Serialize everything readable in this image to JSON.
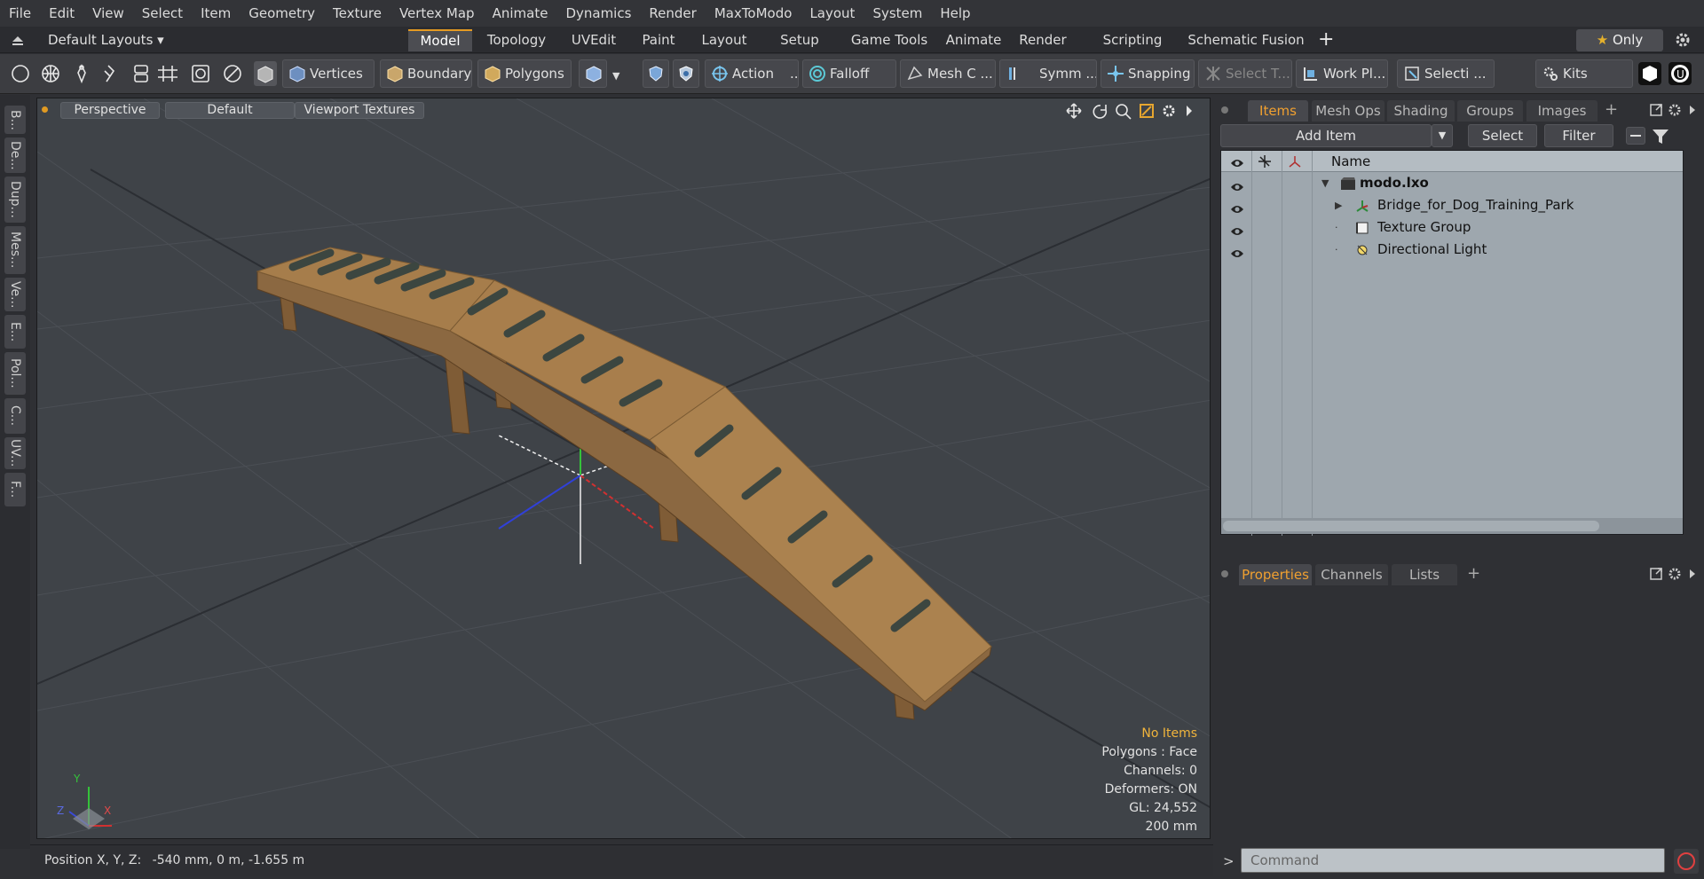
{
  "menu": [
    "File",
    "Edit",
    "View",
    "Select",
    "Item",
    "Geometry",
    "Texture",
    "Vertex Map",
    "Animate",
    "Dynamics",
    "Render",
    "MaxToModo",
    "Layout",
    "System",
    "Help"
  ],
  "layout_selector": "Default Layouts",
  "layout_tabs": [
    "Model",
    "Topology",
    "UVEdit",
    "Paint",
    "Layout",
    "Setup",
    "Game Tools",
    "Animate",
    "Render",
    "Scripting",
    "Schematic Fusion"
  ],
  "active_tab": "Model",
  "only_label": "Only",
  "toolbar": {
    "vertices": "Vertices",
    "boundary": "Boundary",
    "polygons": "Polygons",
    "action": "Action",
    "action_more": "...",
    "falloff": "Falloff",
    "mesh": "Mesh C ...",
    "symm": "Symm ...",
    "snapping": "Snapping",
    "select_t": "Select T...",
    "work_pl": "Work Pl...",
    "selecti": "Selecti ...",
    "kits": "Kits"
  },
  "left_tabs": [
    "B...",
    "De...",
    "Dup...",
    "Mes...",
    "Ve...",
    "E...",
    "Pol...",
    "C...",
    "UV...",
    "F..."
  ],
  "viewport": {
    "perspective": "Perspective",
    "default": "Default",
    "viewport_textures": "Viewport Textures",
    "axis_x_label": "X",
    "axis_y_label": "Y",
    "axis_z_label": "Z",
    "info": {
      "selection": "No Items",
      "polygons": "Polygons : Face",
      "channels": "Channels: 0",
      "deformers": "Deformers: ON",
      "gl": "GL: 24,552",
      "scale": "200 mm"
    }
  },
  "status": {
    "label": "Position X, Y, Z:",
    "value": "-540 mm, 0 m, -1.655 m"
  },
  "items_panel": {
    "tabs": [
      "Items",
      "Mesh Ops",
      "Shading",
      "Groups",
      "Images"
    ],
    "add_item": "Add Item",
    "select": "Select",
    "filter": "Filter",
    "name_header": "Name",
    "rows": [
      {
        "name": "modo.lxo",
        "level": 0,
        "bold": true
      },
      {
        "name": "Bridge_for_Dog_Training_Park",
        "level": 1,
        "bold": false
      },
      {
        "name": "Texture Group",
        "level": 1,
        "bold": false
      },
      {
        "name": "Directional Light",
        "level": 1,
        "bold": false
      }
    ]
  },
  "props_panel": {
    "tabs": [
      "Properties",
      "Channels",
      "Lists"
    ]
  },
  "command_placeholder": "Command",
  "command_prompt": ">",
  "colors": {
    "accent": "#e59a22",
    "viewport_bg": "#3f4348",
    "wood": "#a47a48",
    "bone": "#3c4640"
  }
}
